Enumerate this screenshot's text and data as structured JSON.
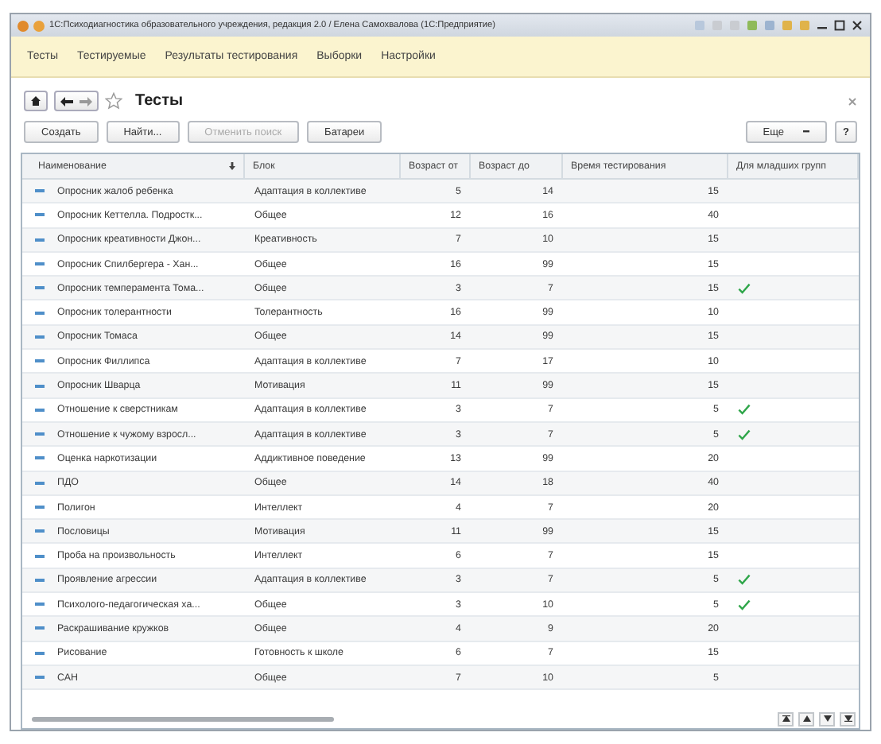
{
  "window": {
    "title": "1С:Психодиагностика образовательного учреждения, редакция 2.0 / Елена Самохвалова  (1С:Предприятие)"
  },
  "menu": [
    "Тесты",
    "Тестируемые",
    "Результаты тестирования",
    "Выборки",
    "Настройки"
  ],
  "form": {
    "title": "Тесты",
    "favorite": false
  },
  "toolbar": [
    {
      "label": "Создать",
      "disabled": false
    },
    {
      "label": "Найти...",
      "disabled": false
    },
    {
      "label": "Отменить поиск",
      "disabled": true
    },
    {
      "label": "Батареи",
      "disabled": false
    }
  ],
  "more_button": "Еще",
  "help_button": "?",
  "table": {
    "columns": [
      "Наименование",
      "Блок",
      "Возраст от",
      "Возраст до",
      "Время тестирования",
      "Для младших групп"
    ],
    "rows": [
      {
        "name": "Опросник жалоб ребенка",
        "block": "Адаптация в коллективе",
        "age_from": "5",
        "age_to": "14",
        "time": "15",
        "junior": false
      },
      {
        "name": "Опросник Кеттелла. Подростк...",
        "block": "Общее",
        "age_from": "12",
        "age_to": "16",
        "time": "40",
        "junior": false
      },
      {
        "name": "Опросник креативности Джон...",
        "block": "Креативность",
        "age_from": "7",
        "age_to": "10",
        "time": "15",
        "junior": false
      },
      {
        "name": "Опросник Спилбергера - Хан...",
        "block": "Общее",
        "age_from": "16",
        "age_to": "99",
        "time": "15",
        "junior": false
      },
      {
        "name": "Опросник темперамента Тома...",
        "block": "Общее",
        "age_from": "3",
        "age_to": "7",
        "time": "15",
        "junior": true
      },
      {
        "name": "Опросник толерантности",
        "block": "Толерантность",
        "age_from": "16",
        "age_to": "99",
        "time": "10",
        "junior": false
      },
      {
        "name": "Опросник Томаса",
        "block": "Общее",
        "age_from": "14",
        "age_to": "99",
        "time": "15",
        "junior": false
      },
      {
        "name": "Опросник Филлипса",
        "block": "Адаптация в коллективе",
        "age_from": "7",
        "age_to": "17",
        "time": "10",
        "junior": false
      },
      {
        "name": "Опросник Шварца",
        "block": "Мотивация",
        "age_from": "11",
        "age_to": "99",
        "time": "15",
        "junior": false
      },
      {
        "name": "Отношение к сверстникам",
        "block": "Адаптация в коллективе",
        "age_from": "3",
        "age_to": "7",
        "time": "5",
        "junior": true
      },
      {
        "name": "Отношение к чужому взросл...",
        "block": "Адаптация в коллективе",
        "age_from": "3",
        "age_to": "7",
        "time": "5",
        "junior": true
      },
      {
        "name": "Оценка наркотизации",
        "block": "Аддиктивное поведение",
        "age_from": "13",
        "age_to": "99",
        "time": "20",
        "junior": false
      },
      {
        "name": "ПДО",
        "block": "Общее",
        "age_from": "14",
        "age_to": "18",
        "time": "40",
        "junior": false
      },
      {
        "name": "Полигон",
        "block": "Интеллект",
        "age_from": "4",
        "age_to": "7",
        "time": "20",
        "junior": false
      },
      {
        "name": "Пословицы",
        "block": "Мотивация",
        "age_from": "11",
        "age_to": "99",
        "time": "15",
        "junior": false
      },
      {
        "name": "Проба на произвольность",
        "block": "Интеллект",
        "age_from": "6",
        "age_to": "7",
        "time": "15",
        "junior": false
      },
      {
        "name": "Проявление агрессии",
        "block": "Адаптация в коллективе",
        "age_from": "3",
        "age_to": "7",
        "time": "5",
        "junior": true
      },
      {
        "name": "Психолого-педагогическая ха...",
        "block": "Общее",
        "age_from": "3",
        "age_to": "10",
        "time": "5",
        "junior": true
      },
      {
        "name": "Раскрашивание кружков",
        "block": "Общее",
        "age_from": "4",
        "age_to": "9",
        "time": "20",
        "junior": false
      },
      {
        "name": "Рисование",
        "block": "Готовность к школе",
        "age_from": "6",
        "age_to": "7",
        "time": "15",
        "junior": false
      },
      {
        "name": "САН",
        "block": "Общее",
        "age_from": "7",
        "age_to": "10",
        "time": "5",
        "junior": false
      }
    ]
  }
}
